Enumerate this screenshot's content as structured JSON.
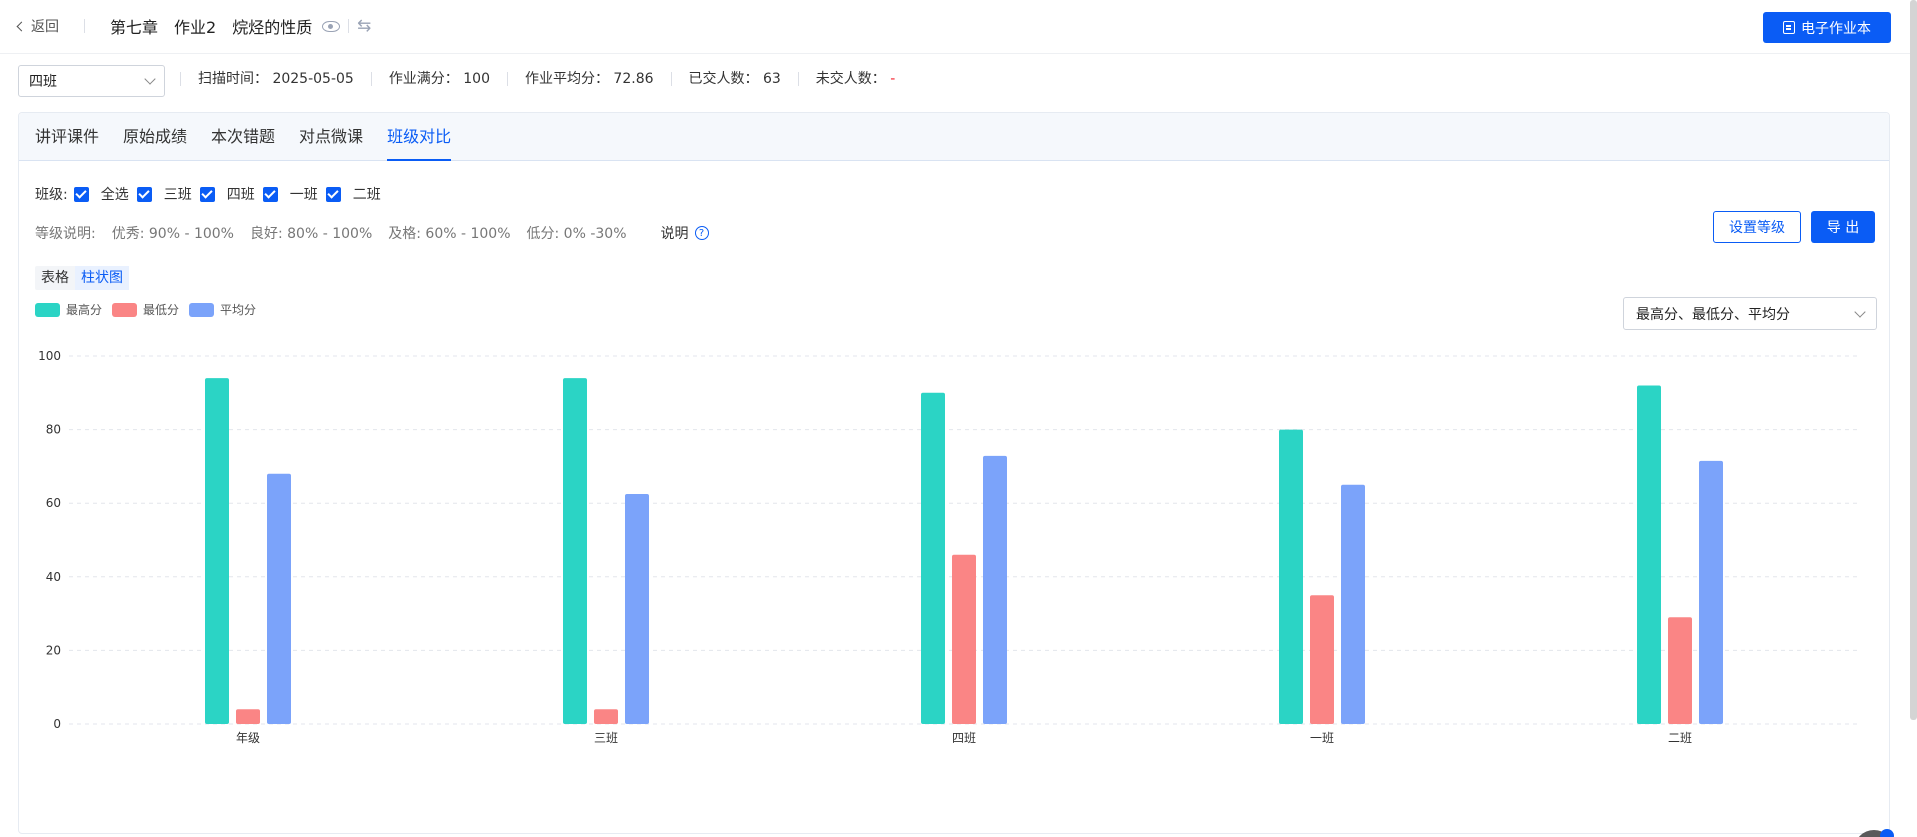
{
  "header": {
    "back_label": "返回",
    "crumbs": [
      "第七章",
      "作业2",
      "烷烃的性质"
    ],
    "ebook_button": "电子作业本"
  },
  "info": {
    "selected_class": "四班",
    "scan_time": "扫描时间： 2025-05-05",
    "full_score": "作业满分： 100",
    "avg_score": "作业平均分： 72.86",
    "submitted": "已交人数： 63",
    "unsubmitted_label": "未交人数：",
    "unsubmitted_value": "-"
  },
  "tabs": [
    "讲评课件",
    "原始成绩",
    "本次错题",
    "对点微课",
    "班级对比"
  ],
  "active_tab": 4,
  "filters": {
    "label": "班级:",
    "options": [
      "全选",
      "三班",
      "四班",
      "一班",
      "二班"
    ]
  },
  "grade_desc": {
    "label": "等级说明:",
    "items": [
      "优秀: 90% - 100%",
      "良好: 80% - 100%",
      "及格: 60% - 100%",
      "低分: 0% -30%"
    ],
    "note": "说明"
  },
  "buttons": {
    "set_level": "设置等级",
    "export": "导 出"
  },
  "view_switch": {
    "table": "表格",
    "bar": "柱状图",
    "active": "bar"
  },
  "metric_select": "最高分、最低分、平均分",
  "colors": {
    "accent": "#0a5cf5",
    "max": "#2bd4c5",
    "min": "#fa8585",
    "avg": "#7ba3fa"
  },
  "chart_data": {
    "type": "bar",
    "categories": [
      "年级",
      "三班",
      "四班",
      "一班",
      "二班"
    ],
    "series": [
      {
        "name": "最高分",
        "values": [
          94,
          94,
          90,
          80,
          92
        ]
      },
      {
        "name": "最低分",
        "values": [
          4,
          4,
          46,
          35,
          29
        ]
      },
      {
        "name": "平均分",
        "values": [
          68,
          62.5,
          72.86,
          65,
          71.5
        ]
      }
    ],
    "ylim": [
      0,
      100
    ],
    "yticks": [
      0,
      20,
      40,
      60,
      80,
      100
    ],
    "grid": true,
    "legend": "top-left"
  }
}
